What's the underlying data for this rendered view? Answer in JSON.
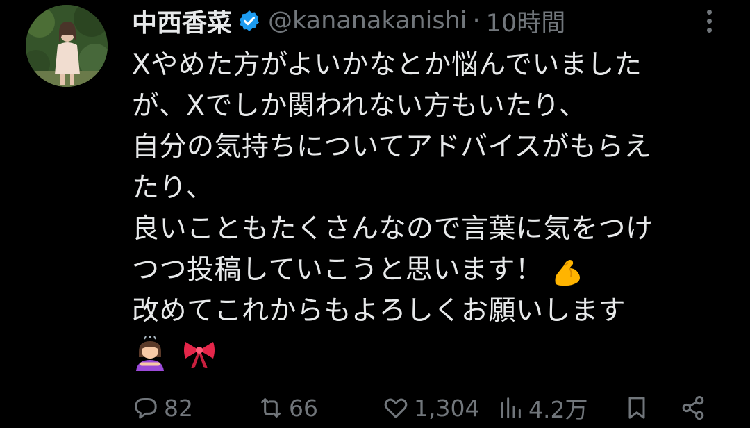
{
  "author": {
    "display_name": "中西香菜",
    "handle": "@kananakanishi",
    "separator": "·",
    "time": "10時間",
    "verified": true,
    "verified_color": "#1d9bf0"
  },
  "tweet": {
    "lines": [
      "Xやめた方がよいかなとか悩んでいました",
      "が、Xでしか関われない方もいたり、",
      "自分の気持ちについてアドバイスがもらえ",
      "たり、",
      "良いこともたくさんなので言葉に気をつけ",
      "つつ投稿していこうと思います！",
      "改めてこれからもよろしくお願いします"
    ],
    "emojis": [
      "flexed-biceps",
      "person-bowing",
      "ribbon"
    ]
  },
  "actions": {
    "replies": "82",
    "retweets": "66",
    "likes": "1,304",
    "views": "4.2万"
  },
  "colors": {
    "background": "#000000",
    "text": "#e7e9ea",
    "muted": "#71767b"
  }
}
